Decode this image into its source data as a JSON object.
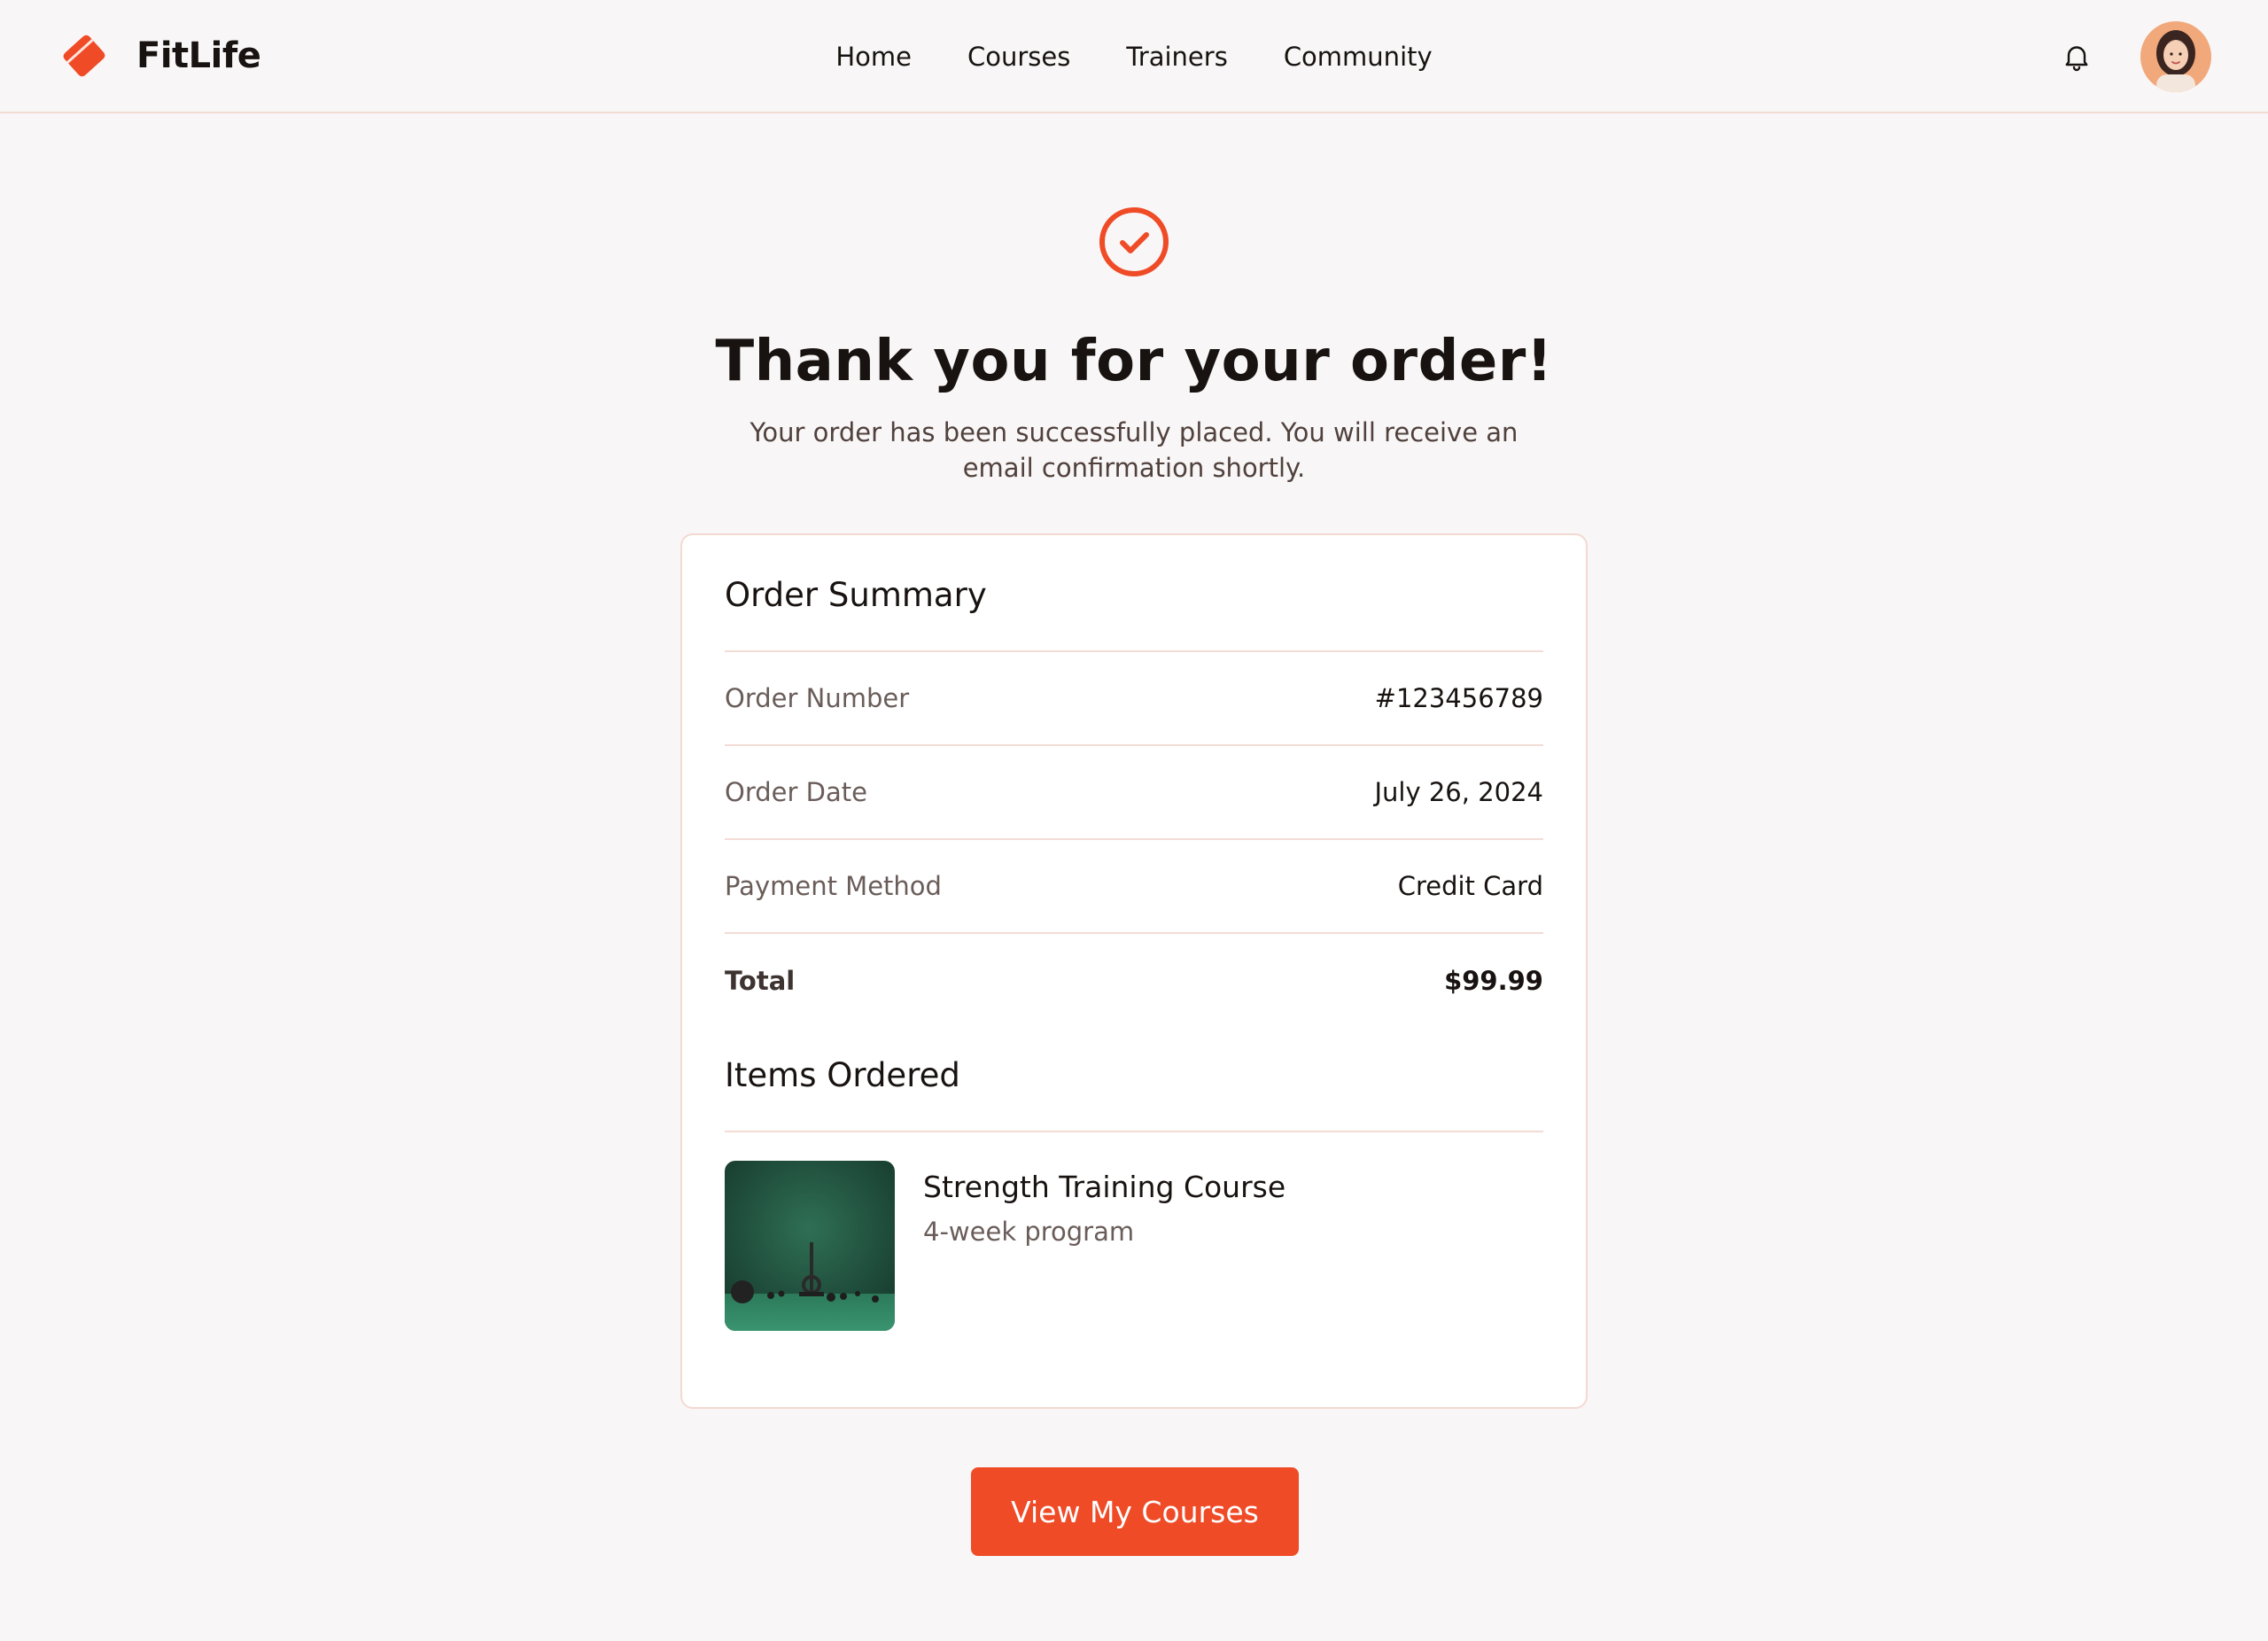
{
  "brand": {
    "name": "FitLife",
    "logo_icon": "tag-logo-icon",
    "accent_color": "#ef4b27"
  },
  "nav": {
    "items": [
      {
        "label": "Home"
      },
      {
        "label": "Courses"
      },
      {
        "label": "Trainers"
      },
      {
        "label": "Community"
      }
    ]
  },
  "header": {
    "notification_icon": "bell-icon",
    "avatar_alt": "user-avatar"
  },
  "hero": {
    "status_icon": "check-circle-icon",
    "title": "Thank you for your order!",
    "subtitle": "Your order has been successfully placed. You will receive an email confirmation shortly."
  },
  "summary": {
    "title": "Order Summary",
    "rows": [
      {
        "label": "Order Number",
        "value": "#123456789"
      },
      {
        "label": "Order Date",
        "value": "July 26, 2024"
      },
      {
        "label": "Payment Method",
        "value": "Credit Card"
      },
      {
        "label": "Total",
        "value": "$99.99"
      }
    ]
  },
  "items": {
    "title": "Items Ordered",
    "list": [
      {
        "name": "Strength Training Course",
        "description": "4-week program",
        "thumbnail": "gym-equipment-photo"
      }
    ]
  },
  "cta": {
    "label": "View My Courses"
  }
}
